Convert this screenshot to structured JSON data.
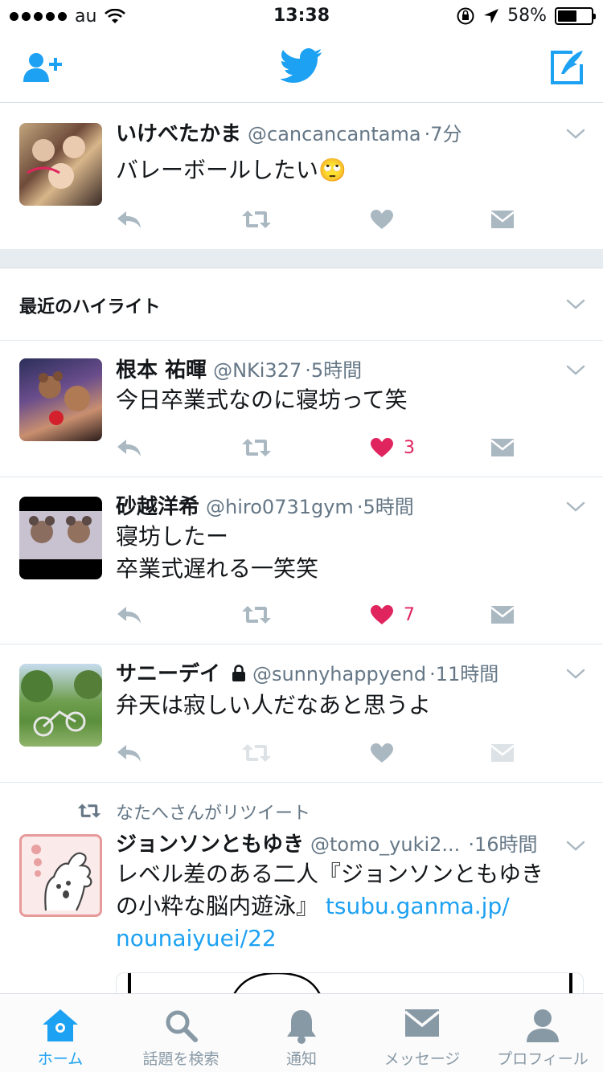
{
  "status_bar": {
    "carrier": "au",
    "time": "13:38",
    "battery": "58%",
    "battery_level": 0.58
  },
  "nav": {
    "left_icon": "add-user-icon",
    "center_icon": "twitter-bird-icon",
    "right_icon": "compose-icon"
  },
  "colors": {
    "brand": "#1da1f2",
    "like": "#e0245e",
    "muted": "#657786",
    "action": "#aab8c2"
  },
  "tweets": [
    {
      "name": "いけべたかま",
      "handle": "@cancancantama",
      "time": "·7分",
      "text": "バレーボールしたい🙄"
    }
  ],
  "highlights": {
    "title": "最近のハイライト"
  },
  "highlight_tweets": [
    {
      "name": "根本 祐暉",
      "handle": "@NKi327",
      "time": "·5時間",
      "text": "今日卒業式なのに寝坊って笑",
      "likes": "3"
    },
    {
      "name": "砂越洋希",
      "handle": "@hiro0731gym",
      "time": "·5時間",
      "text_line1": "寝坊したー",
      "text_line2": "卒業式遅れる一笑笑",
      "likes": "7"
    },
    {
      "name": "サニーデイ",
      "handle": "@sunnyhappyend",
      "time": "·11時間",
      "text": "弁天は寂しい人だなあと思うよ",
      "protected": true
    }
  ],
  "retweet": {
    "retweeted_by": "なたへさんがリツイート",
    "name": "ジョンソンともゆき",
    "handle": "@tomo_yuki2...",
    "time": "·16時間",
    "text_line1": "レベル差のある二人『ジョンソンともゆき",
    "text_line2": "の小粋な脳内遊泳』",
    "link_part1": "tsubu.ganma.jp/",
    "link_part2": "nounaiyuei/22"
  },
  "tabs": [
    {
      "label": "ホーム",
      "icon": "home-icon",
      "active": true
    },
    {
      "label": "話題を検索",
      "icon": "search-icon",
      "active": false
    },
    {
      "label": "通知",
      "icon": "bell-icon",
      "active": false
    },
    {
      "label": "メッセージ",
      "icon": "envelope-icon",
      "active": false
    },
    {
      "label": "プロフィール",
      "icon": "person-icon",
      "active": false
    }
  ]
}
